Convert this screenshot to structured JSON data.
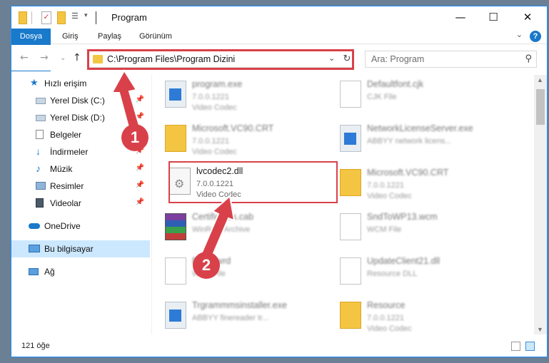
{
  "window": {
    "title": "Program"
  },
  "ribbon": {
    "tabs": [
      "Dosya",
      "Giriş",
      "Paylaş",
      "Görünüm"
    ],
    "help": "?"
  },
  "nav": {
    "path": "C:\\Program Files\\Program Dizini",
    "search_placeholder": "Ara: Program"
  },
  "sidebar": {
    "items": [
      {
        "label": "Hızlı erişim",
        "icon": "star-icon"
      },
      {
        "label": "Yerel Disk (C:)",
        "icon": "drive-icon"
      },
      {
        "label": "Yerel Disk (D:)",
        "icon": "drive-icon"
      },
      {
        "label": "Belgeler",
        "icon": "documents-icon"
      },
      {
        "label": "İndirmeler",
        "icon": "download-icon"
      },
      {
        "label": "Müzik",
        "icon": "music-icon"
      },
      {
        "label": "Resimler",
        "icon": "pictures-icon"
      },
      {
        "label": "Videolar",
        "icon": "video-icon"
      },
      {
        "label": "OneDrive",
        "icon": "cloud-icon"
      },
      {
        "label": "Bu bilgisayar",
        "icon": "computer-icon"
      },
      {
        "label": "Ağ",
        "icon": "network-icon"
      }
    ]
  },
  "files": [
    {
      "name": "program.exe",
      "l2": "7.0.0.1221",
      "l3": "Video Codec",
      "icon": "application"
    },
    {
      "name": "Defaultfont.cjk",
      "l2": "CJK File",
      "l3": "",
      "icon": "document"
    },
    {
      "name": "Microsoft.VC90.CRT",
      "l2": "7.0.0.1221",
      "l3": "Video Codec",
      "icon": "folder"
    },
    {
      "name": "NetworkLicenseServer.exe",
      "l2": "ABBYY network licens...",
      "l3": "",
      "icon": "application"
    },
    {
      "name": "lvcodec2.dll",
      "l2": "7.0.0.1221",
      "l3": "Video Codec",
      "icon": "dll"
    },
    {
      "name": "Microsoft.VC90.CRT",
      "l2": "7.0.0.1221",
      "l3": "Video Codec",
      "icon": "folder"
    },
    {
      "name": "Certificates.cab",
      "l2": "WinRAR Archive",
      "l3": "",
      "icon": "archive"
    },
    {
      "name": "SndToWP13.wcm",
      "l2": "WCM File",
      "l3": "",
      "icon": "document"
    },
    {
      "name": "Basic.wrd",
      "l2": "WRD File",
      "l3": "",
      "icon": "document"
    },
    {
      "name": "UpdateClient21.dll",
      "l2": "Resource DLL",
      "l3": "",
      "icon": "document"
    },
    {
      "name": "Trgrammmsinstaller.exe",
      "l2": "ABBYY finereader tr...",
      "l3": "",
      "icon": "application"
    },
    {
      "name": "Resource",
      "l2": "7.0.0.1221",
      "l3": "Video Codec",
      "icon": "folder"
    }
  ],
  "status": {
    "count": "121 öğe"
  },
  "annotations": {
    "step1": "1",
    "step2": "2",
    "color": "#d9414a"
  }
}
